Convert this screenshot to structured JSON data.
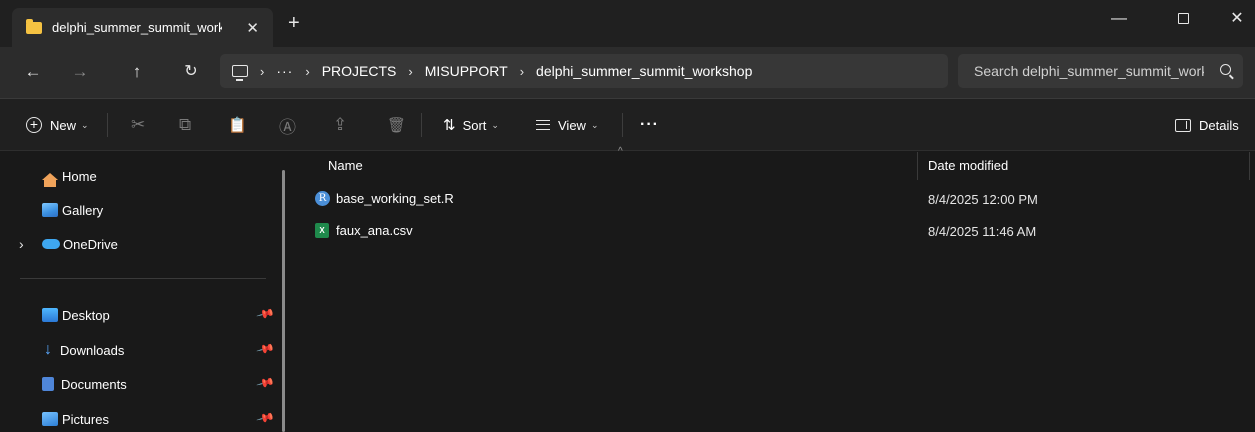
{
  "window": {
    "tab_title": "delphi_summer_summit_works",
    "tab_close": "✕",
    "new_tab": "+",
    "minimize": "—",
    "close": "✕"
  },
  "nav": {
    "back": "←",
    "forward": "→",
    "up": "↑",
    "refresh": "↻"
  },
  "address": {
    "more": "···",
    "sep": "›",
    "crumbs": [
      "PROJECTS",
      "MISUPPORT",
      "delphi_summer_summit_workshop"
    ]
  },
  "search": {
    "placeholder": "Search delphi_summer_summit_workshop"
  },
  "toolbar": {
    "new_label": "New",
    "cut_glyph": "✂",
    "copy_glyph": "⧉",
    "paste_glyph": "📋",
    "rename_glyph": "Ⓐ",
    "share_glyph": "⇪",
    "delete_glyph": "🗑",
    "sort_label": "Sort",
    "sort_glyph": "⇅",
    "view_label": "View",
    "more_label": "···",
    "details_label": "Details",
    "chevron": "⌄"
  },
  "sidebar": {
    "items": [
      {
        "label": "Home"
      },
      {
        "label": "Gallery"
      },
      {
        "label": "OneDrive"
      },
      {
        "label": "Desktop"
      },
      {
        "label": "Downloads"
      },
      {
        "label": "Documents"
      },
      {
        "label": "Pictures"
      }
    ],
    "expand": "›",
    "pin": "📌"
  },
  "columns": {
    "name": "Name",
    "date_modified": "Date modified",
    "sort_caret": "^"
  },
  "files": [
    {
      "name": "base_working_set.R",
      "date": "8/4/2025 12:00 PM",
      "icon_letter": "R"
    },
    {
      "name": "faux_ana.csv",
      "date": "8/4/2025 11:46 AM",
      "icon_letter": "X"
    }
  ],
  "colors": {
    "background": "#191919",
    "tab_active": "#2c2c2c",
    "folder_yellow": "#f5c242",
    "accent_blue": "#4b8fd8",
    "excel_green": "#1f8a4c"
  }
}
